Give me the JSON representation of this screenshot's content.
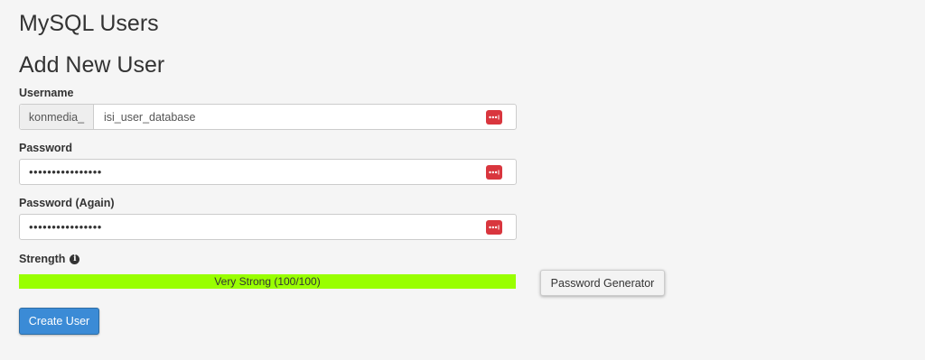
{
  "page": {
    "title": "MySQL Users"
  },
  "add_user": {
    "heading": "Add New User",
    "username": {
      "label": "Username",
      "prefix": "konmedia_",
      "value": "isi_user_database"
    },
    "password": {
      "label": "Password",
      "value": "••••••••••••••••"
    },
    "password_again": {
      "label": "Password (Again)",
      "value": "••••••••••••••••"
    },
    "strength": {
      "label": "Strength",
      "text": "Very Strong (100/100)",
      "value": 100,
      "max": 100,
      "color": "#99ff00"
    },
    "generator_button": "Password Generator",
    "create_button": "Create User"
  },
  "icons": {
    "field_icon": "password-manager-icon",
    "info_icon": "info-icon",
    "field_icon_color": "#d9363e",
    "create_button_color": "#3b8bd6"
  }
}
